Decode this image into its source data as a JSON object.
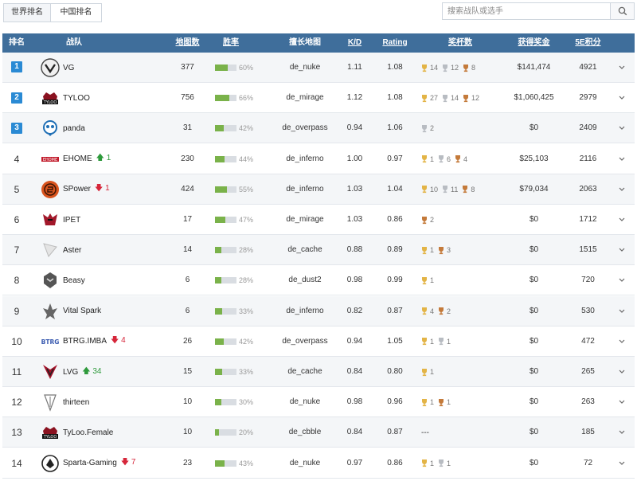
{
  "tabs": [
    {
      "label": "世界排名",
      "active": true
    },
    {
      "label": "中国排名",
      "active": false
    }
  ],
  "search": {
    "placeholder": "搜索战队或选手",
    "icon": "search-icon"
  },
  "columns": [
    "排名",
    "战队",
    "地图数",
    "胜率",
    "擅长地图",
    "K/D",
    "Rating",
    "奖杯数",
    "获得奖金",
    "5E积分"
  ],
  "colors": {
    "header_bg": "#3f6e9b",
    "rank_badge": "#2a8ad4",
    "win_bar": "#7ab24a",
    "up": "#2e9a3c",
    "down": "#d6263a"
  },
  "rows": [
    {
      "rank": "1",
      "badge": true,
      "team": "VG",
      "delta": "",
      "delta_dir": "",
      "maps": "377",
      "winrate": 0.6,
      "winrate_label": "60%",
      "best_map": "de_nuke",
      "kd": "1.11",
      "rating": "1.08",
      "trophies": [
        {
          "c": "gold",
          "n": "14"
        },
        {
          "c": "silver",
          "n": "12"
        },
        {
          "c": "bronze",
          "n": "8"
        }
      ],
      "prize": "$141,474",
      "points": "4921"
    },
    {
      "rank": "2",
      "badge": true,
      "team": "TYLOO",
      "delta": "",
      "delta_dir": "",
      "maps": "756",
      "winrate": 0.66,
      "winrate_label": "66%",
      "best_map": "de_mirage",
      "kd": "1.12",
      "rating": "1.08",
      "trophies": [
        {
          "c": "gold",
          "n": "27"
        },
        {
          "c": "silver",
          "n": "14"
        },
        {
          "c": "bronze",
          "n": "12"
        }
      ],
      "prize": "$1,060,425",
      "points": "2979"
    },
    {
      "rank": "3",
      "badge": true,
      "team": "panda",
      "delta": "",
      "delta_dir": "",
      "maps": "31",
      "winrate": 0.42,
      "winrate_label": "42%",
      "best_map": "de_overpass",
      "kd": "0.94",
      "rating": "1.06",
      "trophies": [
        {
          "c": "silver",
          "n": "2"
        }
      ],
      "prize": "$0",
      "points": "2409"
    },
    {
      "rank": "4",
      "badge": false,
      "team": "EHOME",
      "delta": "1",
      "delta_dir": "up",
      "maps": "230",
      "winrate": 0.44,
      "winrate_label": "44%",
      "best_map": "de_inferno",
      "kd": "1.00",
      "rating": "0.97",
      "trophies": [
        {
          "c": "gold",
          "n": "1"
        },
        {
          "c": "silver",
          "n": "6"
        },
        {
          "c": "bronze",
          "n": "4"
        }
      ],
      "prize": "$25,103",
      "points": "2116"
    },
    {
      "rank": "5",
      "badge": false,
      "team": "SPower",
      "delta": "1",
      "delta_dir": "down",
      "maps": "424",
      "winrate": 0.55,
      "winrate_label": "55%",
      "best_map": "de_inferno",
      "kd": "1.03",
      "rating": "1.04",
      "trophies": [
        {
          "c": "gold",
          "n": "10"
        },
        {
          "c": "silver",
          "n": "11"
        },
        {
          "c": "bronze",
          "n": "8"
        }
      ],
      "prize": "$79,034",
      "points": "2063"
    },
    {
      "rank": "6",
      "badge": false,
      "team": "IPET",
      "delta": "",
      "delta_dir": "",
      "maps": "17",
      "winrate": 0.47,
      "winrate_label": "47%",
      "best_map": "de_mirage",
      "kd": "1.03",
      "rating": "0.86",
      "trophies": [
        {
          "c": "bronze",
          "n": "2"
        }
      ],
      "prize": "$0",
      "points": "1712"
    },
    {
      "rank": "7",
      "badge": false,
      "team": "Aster",
      "delta": "",
      "delta_dir": "",
      "maps": "14",
      "winrate": 0.28,
      "winrate_label": "28%",
      "best_map": "de_cache",
      "kd": "0.88",
      "rating": "0.89",
      "trophies": [
        {
          "c": "gold",
          "n": "1"
        },
        {
          "c": "bronze",
          "n": "3"
        }
      ],
      "prize": "$0",
      "points": "1515"
    },
    {
      "rank": "8",
      "badge": false,
      "team": "Beasy",
      "delta": "",
      "delta_dir": "",
      "maps": "6",
      "winrate": 0.28,
      "winrate_label": "28%",
      "best_map": "de_dust2",
      "kd": "0.98",
      "rating": "0.99",
      "trophies": [
        {
          "c": "gold",
          "n": "1"
        }
      ],
      "prize": "$0",
      "points": "720"
    },
    {
      "rank": "9",
      "badge": false,
      "team": "Vital Spark",
      "delta": "",
      "delta_dir": "",
      "maps": "6",
      "winrate": 0.33,
      "winrate_label": "33%",
      "best_map": "de_inferno",
      "kd": "0.82",
      "rating": "0.87",
      "trophies": [
        {
          "c": "gold",
          "n": "4"
        },
        {
          "c": "bronze",
          "n": "2"
        }
      ],
      "prize": "$0",
      "points": "530"
    },
    {
      "rank": "10",
      "badge": false,
      "team": "BTRG.IMBA",
      "delta": "4",
      "delta_dir": "down",
      "maps": "26",
      "winrate": 0.42,
      "winrate_label": "42%",
      "best_map": "de_overpass",
      "kd": "0.94",
      "rating": "1.05",
      "trophies": [
        {
          "c": "gold",
          "n": "1"
        },
        {
          "c": "silver",
          "n": "1"
        }
      ],
      "prize": "$0",
      "points": "472"
    },
    {
      "rank": "11",
      "badge": false,
      "team": "LVG",
      "delta": "34",
      "delta_dir": "up",
      "maps": "15",
      "winrate": 0.33,
      "winrate_label": "33%",
      "best_map": "de_cache",
      "kd": "0.84",
      "rating": "0.80",
      "trophies": [
        {
          "c": "gold",
          "n": "1"
        }
      ],
      "prize": "$0",
      "points": "265"
    },
    {
      "rank": "12",
      "badge": false,
      "team": "thirteen",
      "delta": "",
      "delta_dir": "",
      "maps": "10",
      "winrate": 0.3,
      "winrate_label": "30%",
      "best_map": "de_nuke",
      "kd": "0.98",
      "rating": "0.96",
      "trophies": [
        {
          "c": "gold",
          "n": "1"
        },
        {
          "c": "bronze",
          "n": "1"
        }
      ],
      "prize": "$0",
      "points": "263"
    },
    {
      "rank": "13",
      "badge": false,
      "team": "TyLoo.Female",
      "delta": "",
      "delta_dir": "",
      "maps": "10",
      "winrate": 0.2,
      "winrate_label": "20%",
      "best_map": "de_cbble",
      "kd": "0.84",
      "rating": "0.87",
      "trophies": [],
      "trophies_empty": "---",
      "prize": "$0",
      "points": "185"
    },
    {
      "rank": "14",
      "badge": false,
      "team": "Sparta-Gaming",
      "delta": "7",
      "delta_dir": "down",
      "maps": "23",
      "winrate": 0.43,
      "winrate_label": "43%",
      "best_map": "de_nuke",
      "kd": "0.97",
      "rating": "0.86",
      "trophies": [
        {
          "c": "gold",
          "n": "1"
        },
        {
          "c": "silver",
          "n": "1"
        }
      ],
      "prize": "$0",
      "points": "72"
    }
  ]
}
